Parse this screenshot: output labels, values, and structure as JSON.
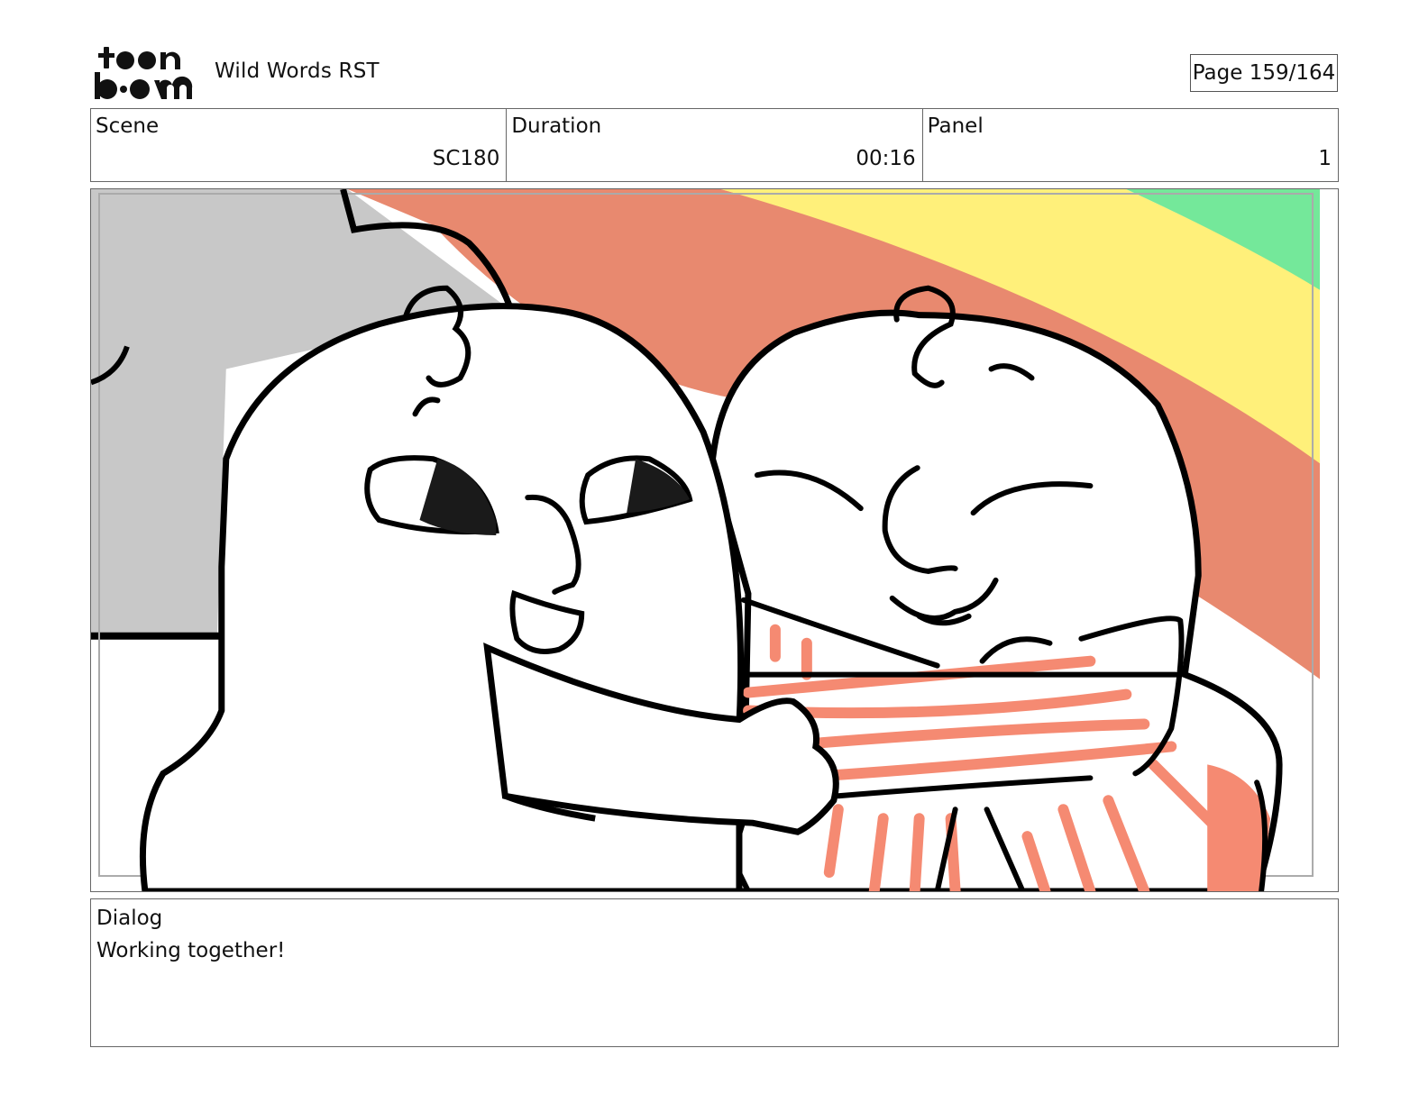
{
  "header": {
    "logo_text_top": "toon",
    "logo_text_bottom": "boom",
    "project_title": "Wild Words RST",
    "page_indicator": "Page 159/164"
  },
  "info": {
    "scene_label": "Scene",
    "scene_value": "SC180",
    "duration_label": "Duration",
    "duration_value": "00:16",
    "panel_label": "Panel",
    "panel_value": "1"
  },
  "dialog": {
    "label": "Dialog",
    "text": "Working together!"
  },
  "colors": {
    "rainbow_red": "#e8896f",
    "rainbow_yellow": "#fff07a",
    "rainbow_green": "#74e89a",
    "wall_gray": "#c8c8c8",
    "shirt_stripes": "#f58a72"
  }
}
